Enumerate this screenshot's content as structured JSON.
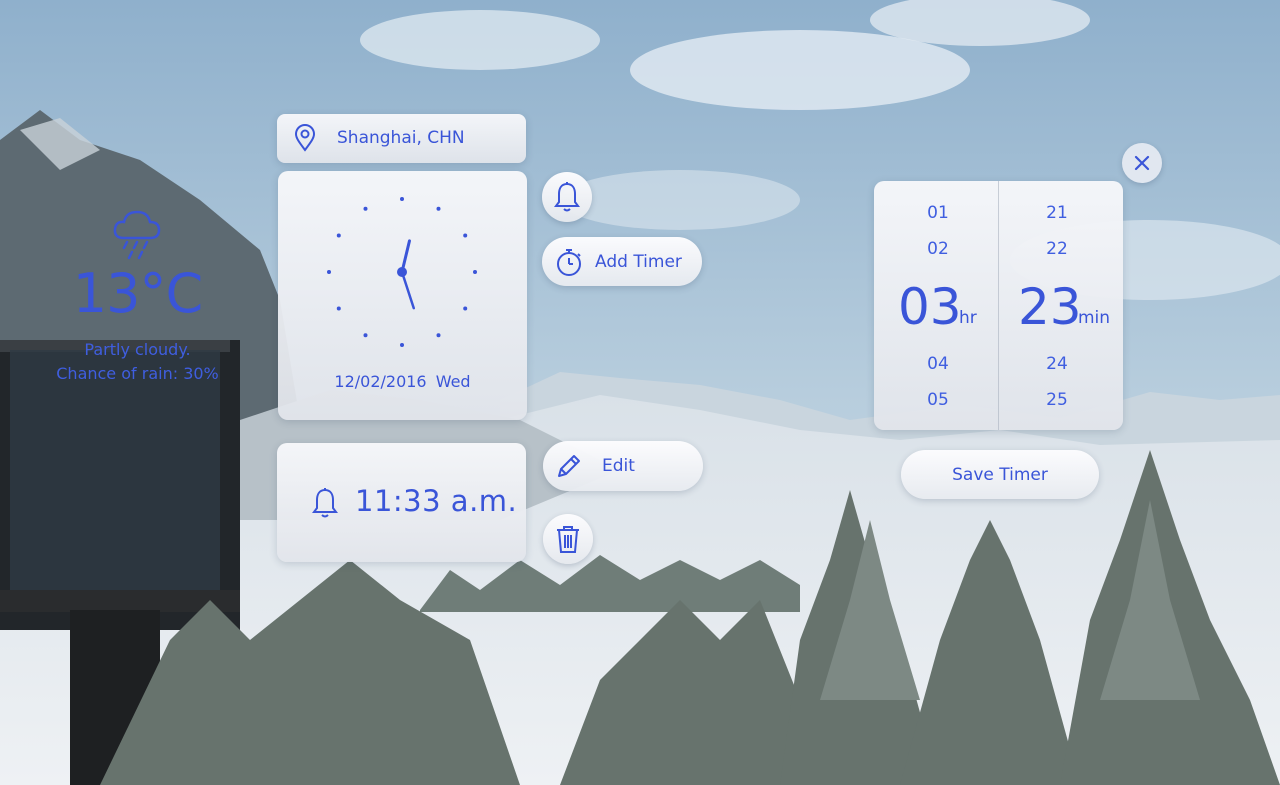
{
  "location": {
    "label": "Shanghai, CHN",
    "icon": "location-pin-icon"
  },
  "weather": {
    "icon": "rain-cloud-icon",
    "temperature": "13°C",
    "description_line1": "Partly cloudy.",
    "description_line2": "Chance of rain: 30%"
  },
  "clock": {
    "date": "12/02/2016",
    "weekday": "Wed",
    "hour": 12,
    "minute": 27,
    "colors": {
      "accent": "#3a55d8"
    }
  },
  "alarm": {
    "icon": "bell-icon",
    "time": "11:33 a.m."
  },
  "actions": {
    "bell": {
      "icon": "bell-icon"
    },
    "add_timer": {
      "label": "Add Timer",
      "icon": "stopwatch-icon"
    },
    "edit": {
      "label": "Edit",
      "icon": "pencil-icon"
    },
    "delete": {
      "icon": "trash-icon"
    }
  },
  "timer": {
    "close_icon": "close-icon",
    "hours": {
      "above": [
        "01",
        "02"
      ],
      "selected": "03",
      "below": [
        "04",
        "05"
      ],
      "unit": "hr"
    },
    "minutes": {
      "above": [
        "21",
        "22"
      ],
      "selected": "23",
      "below": [
        "24",
        "25"
      ],
      "unit": "min"
    },
    "save_label": "Save Timer"
  }
}
